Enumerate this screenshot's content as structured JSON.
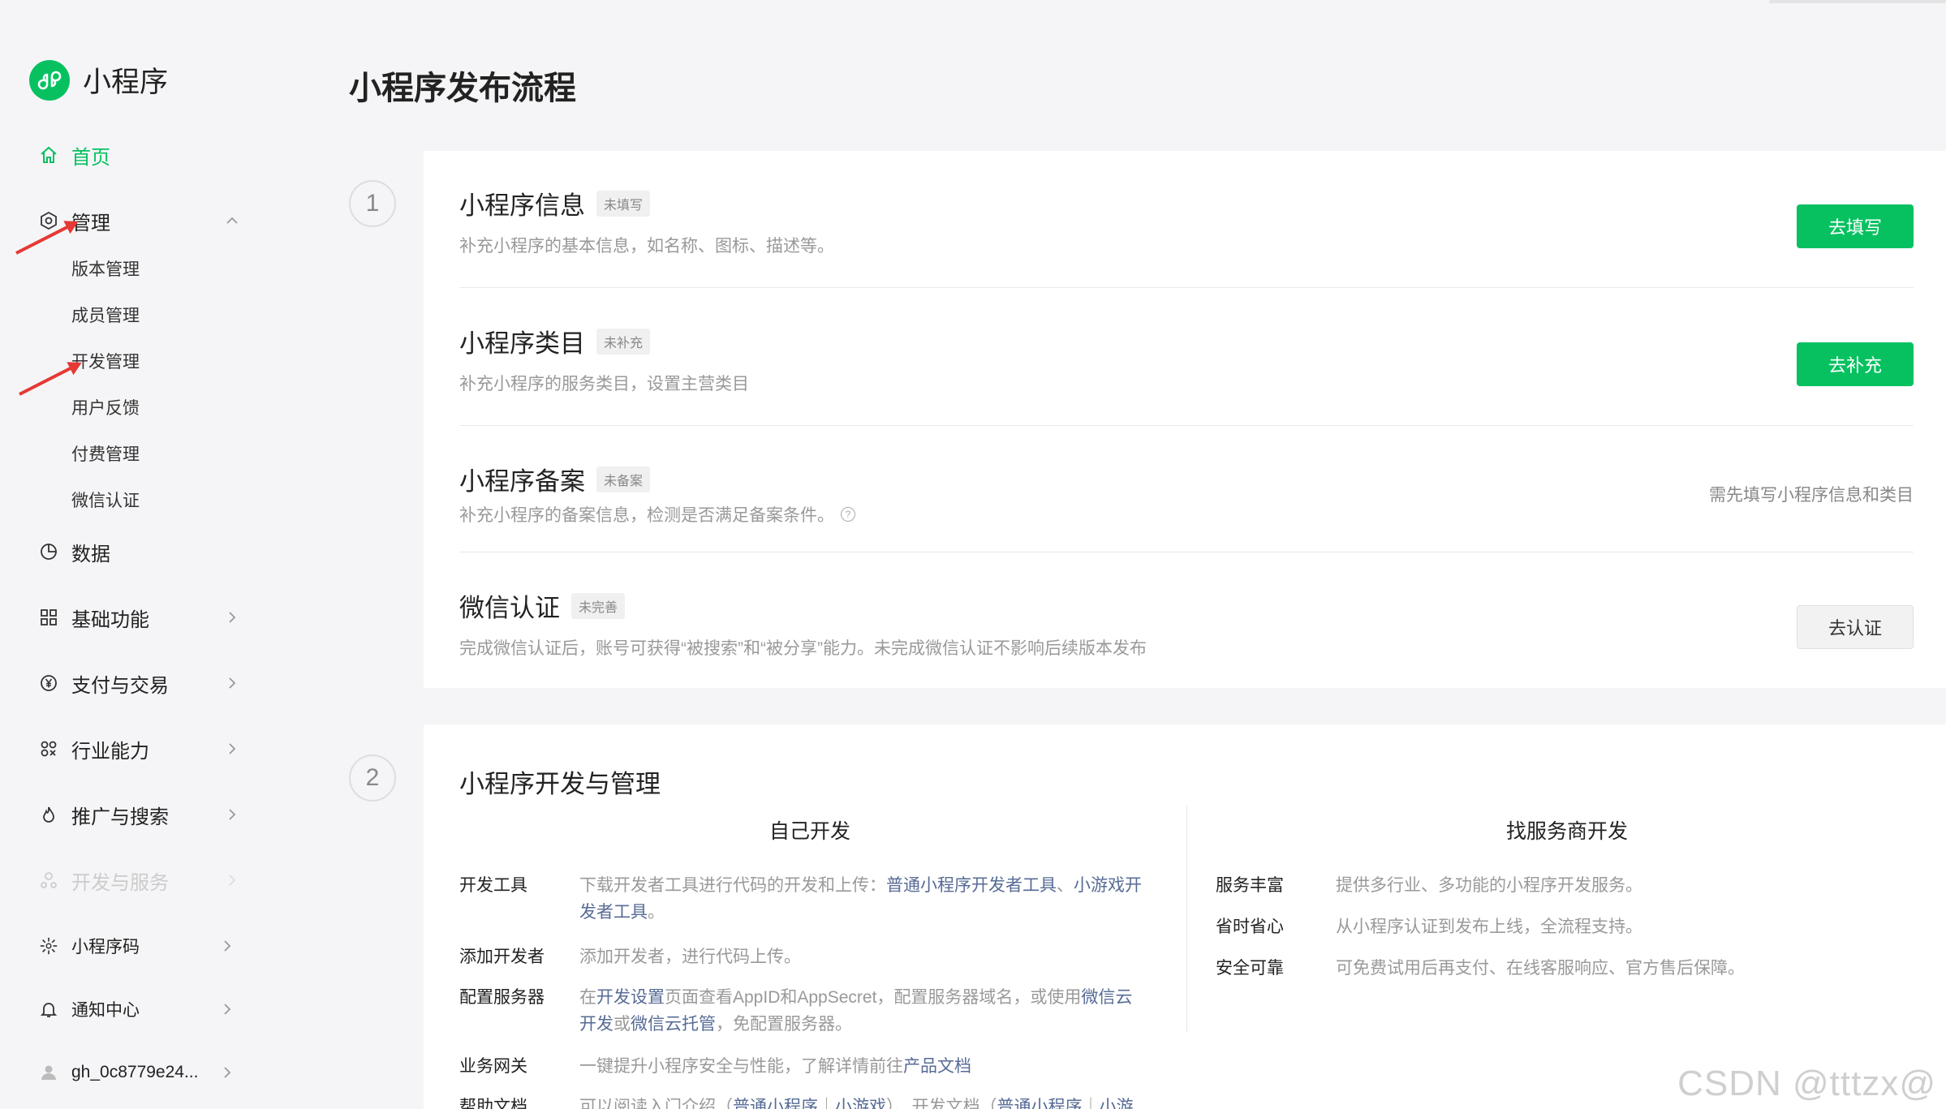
{
  "app": {
    "name": "小程序",
    "page_title": "小程序发布流程",
    "brand_color": "#07c160"
  },
  "sidebar": {
    "home": "首页",
    "manage": "管理",
    "manage_sub": [
      "版本管理",
      "成员管理",
      "开发管理",
      "用户反馈",
      "付费管理",
      "微信认证"
    ],
    "data": "数据",
    "basic": "基础功能",
    "pay": "支付与交易",
    "industry": "行业能力",
    "promo": "推广与搜索",
    "devservice": "开发与服务",
    "qrcode": "小程序码",
    "notice": "通知中心",
    "account": "gh_0c8779e24..."
  },
  "step1": {
    "num": "1",
    "rows": [
      {
        "title": "小程序信息",
        "tag": "未填写",
        "desc": "补充小程序的基本信息，如名称、图标、描述等。",
        "button": "去填写"
      },
      {
        "title": "小程序类目",
        "tag": "未补充",
        "desc": "补充小程序的服务类目，设置主营类目",
        "button": "去补充"
      },
      {
        "title": "小程序备案",
        "tag": "未备案",
        "desc": "补充小程序的备案信息，检测是否满足备案条件。",
        "hint": "需先填写小程序信息和类目"
      },
      {
        "title": "微信认证",
        "tag": "未完善",
        "desc": "完成微信认证后，账号可获得“被搜索”和“被分享”能力。未完成微信认证不影响后续版本发布",
        "button": "去认证"
      }
    ]
  },
  "step2": {
    "num": "2",
    "title": "小程序开发与管理",
    "self_title": "自己开发",
    "vendor_title": "找服务商开发",
    "self_items": {
      "tools_key": "开发工具",
      "tools_a": "下载开发者工具进行代码的开发和上传：",
      "tools_link1": "普通小程序开发者工具",
      "tools_sep": "、",
      "tools_link2a": "小游戏开",
      "tools_link2b": "发者工具",
      "tools_end": "。",
      "add_key": "添加开发者",
      "add_val": "添加开发者，进行代码上传。",
      "server_key": "配置服务器",
      "server_a": "在",
      "server_link1": "开发设置",
      "server_b": "页面查看AppID和AppSecret，配置服务器域名，或使用",
      "server_link2a": "微信云",
      "server_link2b": "开发",
      "server_c": "或",
      "server_link3": "微信云托管",
      "server_d": "，免配置服务器。",
      "domain_key": "业务网关",
      "domain_a": "一键提升小程序安全与性能，了解详情前往",
      "domain_link": "产品文档",
      "help_key": "帮助文档",
      "help_a": "可以阅读入门介绍（",
      "help_link1": "普通小程序",
      "help_sep1": "｜",
      "help_link2": "小游戏",
      "help_b": "）、开发文档（",
      "help_link3": "普通小程序",
      "help_sep2": "｜",
      "help_link4": "小游"
    },
    "vendor_items": [
      {
        "key": "服务丰富",
        "val": "提供多行业、多功能的小程序开发服务。"
      },
      {
        "key": "省时省心",
        "val": "从小程序认证到发布上线，全流程支持。"
      },
      {
        "key": "安全可靠",
        "val": "可免费试用后再支付、在线客服响应、官方售后保障。"
      }
    ]
  },
  "watermark": "CSDN @tttzx@"
}
